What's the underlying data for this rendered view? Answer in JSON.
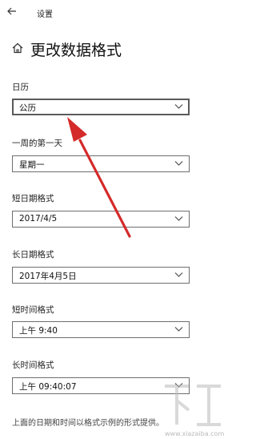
{
  "titlebar": {
    "app_title": "设置",
    "back_icon": "back-arrow-icon"
  },
  "header": {
    "home_icon": "home-icon",
    "title": "更改数据格式"
  },
  "settings": [
    {
      "label": "日历",
      "value": "公历"
    },
    {
      "label": "一周的第一天",
      "value": "星期一"
    },
    {
      "label": "短日期格式",
      "value": "2017/4/5"
    },
    {
      "label": "长日期格式",
      "value": "2017年4月5日"
    },
    {
      "label": "短时间格式",
      "value": "上午 9:40"
    },
    {
      "label": "长时间格式",
      "value": "上午 09:40:07"
    }
  ],
  "footer": {
    "text": "上面的日期和时间以格式示例的形式提供。"
  },
  "watermark": {
    "url": "www.xiazaiba.com"
  },
  "colors": {
    "annotation_arrow": "#d42a2a",
    "dropdown_border": "#6e6e6e",
    "focused_border": "#5a5a5a"
  }
}
